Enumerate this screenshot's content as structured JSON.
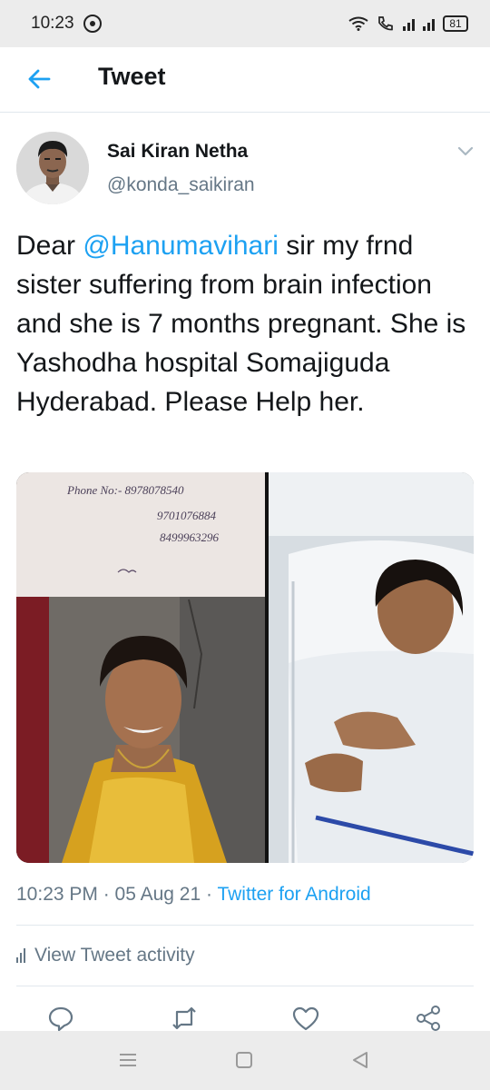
{
  "status_bar": {
    "time": "10:23",
    "battery": "81"
  },
  "header": {
    "title": "Tweet"
  },
  "tweet": {
    "author_name": "Sai Kiran Netha",
    "author_handle": "@konda_saikiran",
    "text_prefix": "Dear ",
    "mention": "@Hanumavihari",
    "text_suffix": " sir my frnd sister suffering from brain infection and she is 7 months pregnant. She is Yashodha hospital Somajiguda Hyderabad. Please Help her.",
    "image_note": {
      "line1": "Phone No:- 8978078540",
      "line2": "9701076884",
      "line3": "8499963296"
    },
    "timestamp": "10:23 PM · 05 Aug 21 · ",
    "source": "Twitter for Android",
    "activity_label": "View Tweet activity"
  },
  "colors": {
    "accent": "#1da1f2",
    "secondary_text": "#657786",
    "divider": "#e1e8ed"
  },
  "icons": {
    "back": "arrow-left-icon",
    "caret": "chevron-down-icon",
    "reply": "reply-icon",
    "retweet": "retweet-icon",
    "like": "heart-icon",
    "share": "share-icon"
  }
}
